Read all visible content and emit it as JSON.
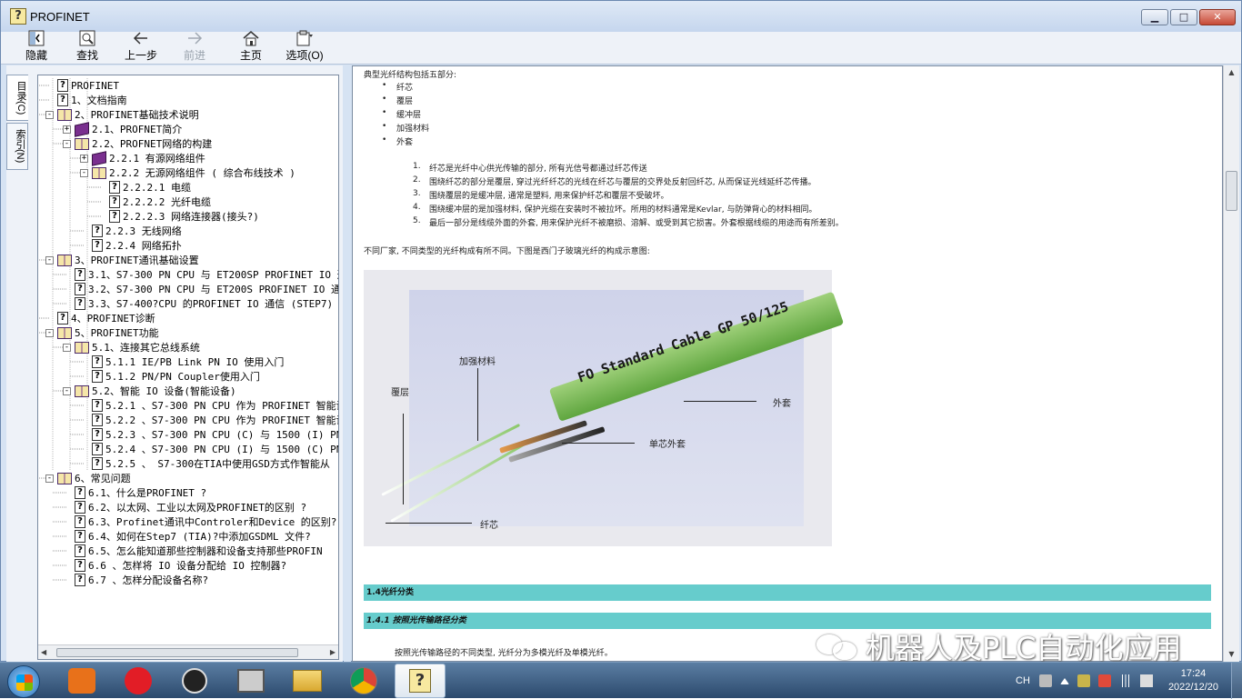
{
  "window": {
    "title": "PROFINET",
    "minimize": "▁",
    "maximize": "□",
    "close": "✕"
  },
  "toolbar": {
    "hide": "隐藏",
    "find": "查找",
    "back": "上一步",
    "forward": "前进",
    "home": "主页",
    "options": "选项(O)"
  },
  "tabs": {
    "contents": "目录(C)",
    "index": "索引(N)"
  },
  "tree": [
    {
      "label": "PROFINET",
      "level": 0,
      "icon": "topic"
    },
    {
      "label": "1、文档指南",
      "level": 0,
      "icon": "topic"
    },
    {
      "label": "2、PROFINET基础技术说明",
      "level": 0,
      "icon": "book-open",
      "exp": "-"
    },
    {
      "label": "2.1、PROFNET简介",
      "level": 1,
      "icon": "book-closed",
      "exp": "+"
    },
    {
      "label": "2.2、PROFNET网络的构建",
      "level": 1,
      "icon": "book-open",
      "exp": "-"
    },
    {
      "label": "2.2.1 有源网络组件",
      "level": 2,
      "icon": "book-closed",
      "exp": "+"
    },
    {
      "label": "2.2.2 无源网络组件 ( 综合布线技术 )",
      "level": 2,
      "icon": "book-open",
      "exp": "-"
    },
    {
      "label": "2.2.2.1 电缆",
      "level": 3,
      "icon": "topic"
    },
    {
      "label": "2.2.2.2 光纤电缆",
      "level": 3,
      "icon": "topic"
    },
    {
      "label": "2.2.2.3 网络连接器(接头?)",
      "level": 3,
      "icon": "topic"
    },
    {
      "label": "2.2.3 无线网络",
      "level": 2,
      "icon": "topic"
    },
    {
      "label": "2.2.4 网络拓扑",
      "level": 2,
      "icon": "topic"
    },
    {
      "label": "3、PROFINET通讯基础设置",
      "level": 0,
      "icon": "book-open",
      "exp": "-"
    },
    {
      "label": "3.1、S7-300 PN CPU 与 ET200SP PROFINET IO 通信",
      "level": 1,
      "icon": "topic"
    },
    {
      "label": "3.2、S7-300 PN CPU 与 ET200S PROFINET IO 通信",
      "level": 1,
      "icon": "topic"
    },
    {
      "label": "3.3、S7-400?CPU 的PROFINET IO 通信 (STEP7)",
      "level": 1,
      "icon": "topic"
    },
    {
      "label": "4、PROFINET诊断",
      "level": 0,
      "icon": "topic"
    },
    {
      "label": "5、PROFINET功能",
      "level": 0,
      "icon": "book-open",
      "exp": "-"
    },
    {
      "label": "5.1、连接其它总线系统",
      "level": 1,
      "icon": "book-open",
      "exp": "-"
    },
    {
      "label": "5.1.1 IE/PB Link PN IO 使用入门",
      "level": 2,
      "icon": "topic"
    },
    {
      "label": "5.1.2 PN/PN Coupler使用入门",
      "level": 2,
      "icon": "topic"
    },
    {
      "label": "5.2、智能 IO 设备(智能设备)",
      "level": 1,
      "icon": "book-open",
      "exp": "-"
    },
    {
      "label": "5.2.1 、S7-300 PN CPU 作为 PROFINET 智能设",
      "level": 2,
      "icon": "topic"
    },
    {
      "label": "5.2.2 、S7-300 PN CPU 作为 PROFINET 智能设",
      "level": 2,
      "icon": "topic"
    },
    {
      "label": "5.2.3 、S7-300 PN CPU (C) 与 1500 (I) PN",
      "level": 2,
      "icon": "topic"
    },
    {
      "label": "5.2.4 、S7-300 PN CPU (I) 与 1500 (C) PN",
      "level": 2,
      "icon": "topic"
    },
    {
      "label": "5.2.5 、 S7-300在TIA中使用GSD方式作智能从",
      "level": 2,
      "icon": "topic"
    },
    {
      "label": "6、常见问题",
      "level": 0,
      "icon": "book-open",
      "exp": "-"
    },
    {
      "label": "6.1、什么是PROFINET ?",
      "level": 1,
      "icon": "topic"
    },
    {
      "label": "6.2、以太网、工业以太网及PROFINET的区别 ?",
      "level": 1,
      "icon": "topic"
    },
    {
      "label": "6.3、Profinet通讯中Controler和Device 的区别?",
      "level": 1,
      "icon": "topic"
    },
    {
      "label": "6.4、如何在Step7 (TIA)?中添加GSDML 文件?",
      "level": 1,
      "icon": "topic"
    },
    {
      "label": "6.5、怎么能知道那些控制器和设备支持那些PROFIN",
      "level": 1,
      "icon": "topic"
    },
    {
      "label": "6.6 、怎样将 IO 设备分配给 IO 控制器?",
      "level": 1,
      "icon": "topic"
    },
    {
      "label": "6.7 、怎样分配设备名称?",
      "level": 1,
      "icon": "topic"
    }
  ],
  "content": {
    "intro": "典型光纤结构包括五部分:",
    "bullets": [
      "纤芯",
      "覆层",
      "缓冲层",
      "加强材料",
      "外套"
    ],
    "numbered": [
      "纤芯是光纤中心供光传输的部分, 所有光信号都通过纤芯传送",
      "围绕纤芯的部分是覆层, 穿过光纤纤芯的光线在纤芯与覆层的交界处反射回纤芯, 从而保证光线延纤芯传播。",
      "围绕覆层的是缓冲层, 通常是塑料, 用来保护纤芯和覆层不受破坏。",
      "围绕缓冲层的是加强材料, 保护光缆在安装时不被拉坏。所用的材料通常是Kevlar, 与防弹背心的材料相同。",
      "最后一部分是线缆外面的外套, 用来保护光纤不被磨损、溶解、或受到其它损害。外套根据线缆的用途而有所差别。"
    ],
    "numbers": [
      "1.",
      "2.",
      "3.",
      "4.",
      "5."
    ],
    "note": "不同厂家, 不同类型的光纤构成有所不同。下图是西门子玻璃光纤的构成示意图:",
    "figure": {
      "cable_text": "FO Standard Cable GP 50/125",
      "labels": {
        "strength": "加强材料",
        "cladding": "覆层",
        "jacket": "外套",
        "single_jacket": "单芯外套",
        "core": "纤芯"
      }
    },
    "section1": "1.4光纤分类",
    "section2": "1.4.1 按照光传输路径分类",
    "section_text": "按照光传输路径的不同类型, 光纤分为多模光纤及单模光纤。"
  },
  "watermark": "机器人及PLC自动化应用",
  "taskbar": {
    "apps": [
      "orangehouse",
      "netease-music",
      "feather-app",
      "film-app",
      "file-explorer",
      "chrome",
      "help-viewer"
    ],
    "tray": {
      "lang": "CH",
      "time": "17:24",
      "date": "2022/12/20"
    }
  }
}
